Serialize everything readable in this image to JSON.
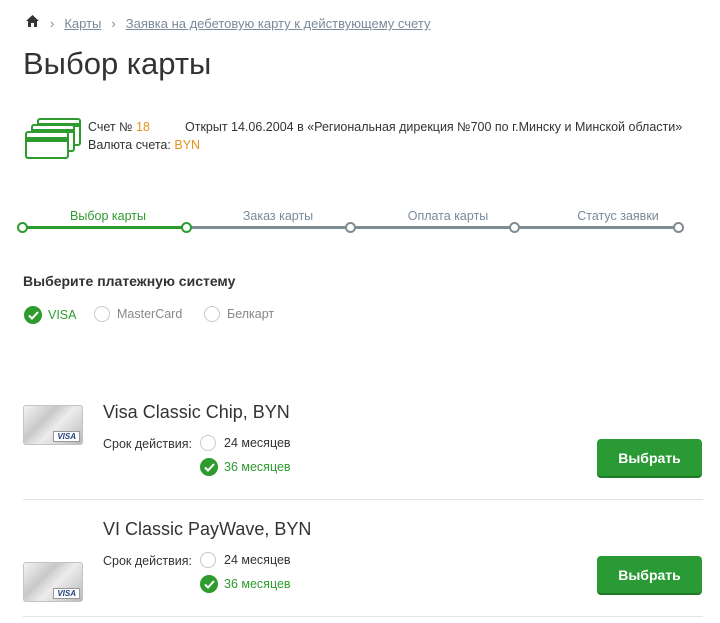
{
  "breadcrumb": {
    "items": [
      "Карты",
      "Заявка на дебетовую карту к действующему счету"
    ]
  },
  "page_title": "Выбор карты",
  "account": {
    "number_label": "Счет №",
    "number": "18",
    "opened": "Открыт 14.06.2004 в «Региональная дирекция №700 по г.Минску и Минской области»",
    "currency_label": "Валюта счета:",
    "currency": "BYN"
  },
  "steps": [
    "Выбор карты",
    "Заказ карты",
    "Оплата карты",
    "Статус заявки"
  ],
  "payment": {
    "heading": "Выберите платежную систему",
    "options": [
      "VISA",
      "MasterCard",
      "Белкарт"
    ],
    "selected": "VISA"
  },
  "cards": [
    {
      "name": "Visa Classic Chip, BYN",
      "term_label": "Срок действия:",
      "terms": [
        "24 месяцев",
        "36 месяцев"
      ],
      "selected_term": "36 месяцев",
      "button": "Выбрать",
      "badge": "VISA"
    },
    {
      "name": "VI Classic PayWave, BYN",
      "term_label": "Срок действия:",
      "terms": [
        "24 месяцев",
        "36 месяцев"
      ],
      "selected_term": "36 месяцев",
      "button": "Выбрать",
      "badge": "VISA"
    }
  ],
  "colors": {
    "accent": "#2e9b2e",
    "orange": "#e3941d",
    "link": "#7a8a99"
  }
}
